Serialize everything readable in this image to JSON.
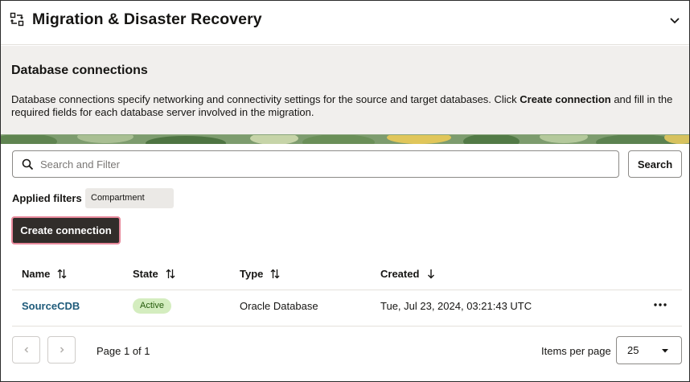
{
  "header": {
    "title": "Migration & Disaster Recovery",
    "icon": "migration-icon"
  },
  "banner": {
    "heading": "Database connections",
    "desc_part1": "Database connections specify networking and connectivity settings for the source and target databases. Click ",
    "desc_bold": "Create connection",
    "desc_part2": " and fill in the required fields for each database server involved in the migration."
  },
  "search": {
    "placeholder": "Search and Filter",
    "button_label": "Search"
  },
  "filters": {
    "label": "Applied filters",
    "chips": [
      "Compartment"
    ]
  },
  "create_button_label": "Create connection",
  "table": {
    "columns": [
      "Name",
      "State",
      "Type",
      "Created"
    ],
    "rows": [
      {
        "name": "SourceCDB",
        "state": "Active",
        "type": "Oracle Database",
        "created": "Tue, Jul 23, 2024, 03:21:43 UTC"
      }
    ]
  },
  "pagination": {
    "page_label": "Page 1 of 1",
    "items_per_page_label": "Items per page",
    "items_per_page_value": "25"
  },
  "colors": {
    "primary_button": "#312d2a",
    "focus_ring": "#e7889b",
    "link": "#1f5b7a",
    "active_badge_bg": "#d4edbf",
    "banner_bg": "#f1efed"
  }
}
